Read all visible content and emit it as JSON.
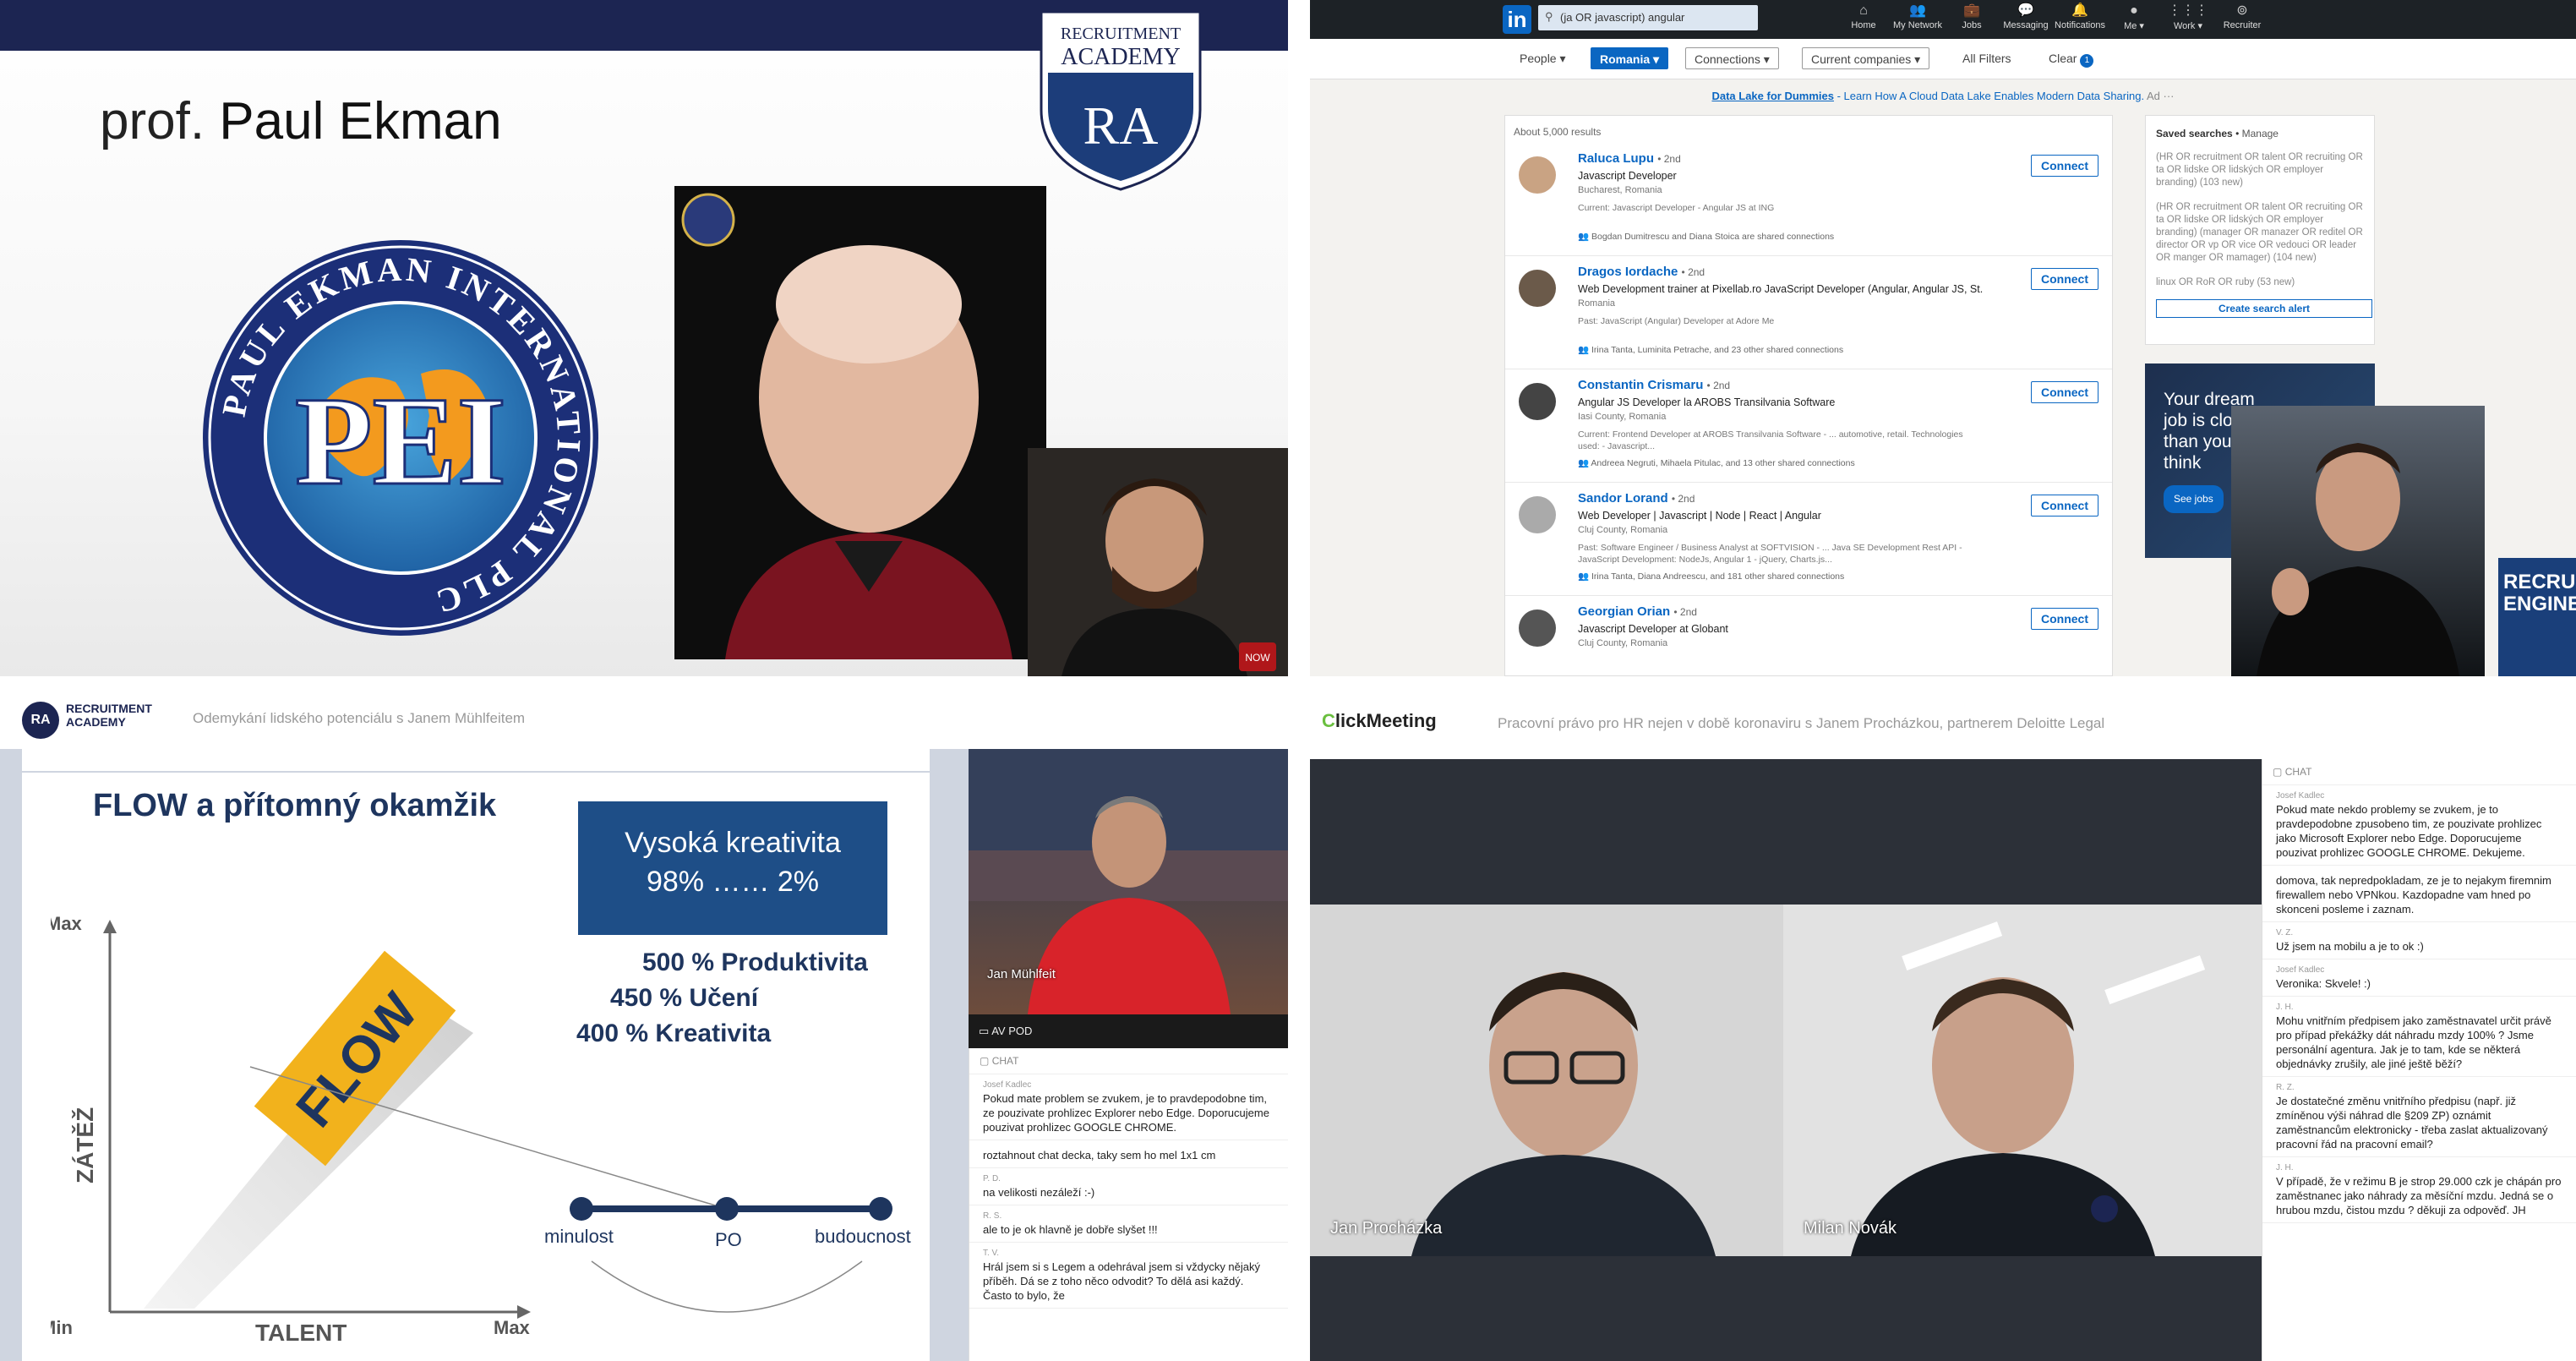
{
  "q1": {
    "title_prefix": "prof. ",
    "title_name": "Paul Ekman",
    "ra_shield": {
      "line1": "RECRUITMENT",
      "line2": "ACADEMY",
      "mono": "RA"
    },
    "pei_logo": {
      "initials": "PEI",
      "ring_text": "PAUL EKMAN INTERNATIONAL PLC"
    },
    "badge": "NOW"
  },
  "q2": {
    "search": "(ja OR javascript) angular",
    "nav": [
      {
        "icon": "home-icon",
        "glyph": "⌂",
        "label": "Home"
      },
      {
        "icon": "network-icon",
        "glyph": "👥",
        "label": "My Network"
      },
      {
        "icon": "jobs-icon",
        "glyph": "💼",
        "label": "Jobs"
      },
      {
        "icon": "messaging-icon",
        "glyph": "💬",
        "label": "Messaging"
      },
      {
        "icon": "notifications-icon",
        "glyph": "🔔",
        "label": "Notifications"
      },
      {
        "icon": "me-icon",
        "glyph": "●",
        "label": "Me ▾"
      },
      {
        "icon": "work-icon",
        "glyph": "⋮⋮⋮",
        "label": "Work ▾"
      },
      {
        "icon": "recruiter-icon",
        "glyph": "⊚",
        "label": "Recruiter"
      }
    ],
    "filters": {
      "people": "People ▾",
      "romania": "Romania ▾",
      "connections": "Connections ▾",
      "current": "Current companies ▾",
      "all": "All Filters",
      "clear": "Clear",
      "clear_count": "1"
    },
    "ad": {
      "link": "Data Lake for Dummies",
      "text": " - Learn How A Cloud Data Lake Enables Modern Data Sharing.",
      "tag": "Ad"
    },
    "count": "About 5,000 results",
    "connect_label": "Connect",
    "results": [
      {
        "name": "Raluca Lupu",
        "degree": "• 2nd",
        "headline": "Javascript Developer",
        "location": "Bucharest, Romania",
        "current": "Current: Javascript Developer - Angular JS at ING",
        "shared": "Bogdan Dumitrescu and Diana Stoica are shared connections"
      },
      {
        "name": "Dragos Iordache",
        "degree": "• 2nd",
        "headline": "Web Development trainer at Pixellab.ro JavaScript Developer (Angular, Angular JS, St...",
        "location": "Romania",
        "current": "Past: JavaScript (Angular) Developer at Adore Me",
        "shared": "Irina Tanta, Luminita Petrache, and 23 other shared connections"
      },
      {
        "name": "Constantin Crismaru",
        "degree": "• 2nd",
        "headline": "Angular JS Developer la AROBS Transilvania Software",
        "location": "Iasi County, Romania",
        "current": "Current: Frontend Developer at AROBS Transilvania Software - ... automotive, retail. Technologies used: - Javascript...",
        "shared": "Andreea Negruti, Mihaela Pitulac, and 13 other shared connections"
      },
      {
        "name": "Sandor Lorand",
        "degree": "• 2nd",
        "headline": "Web Developer | Javascript | Node | React | Angular",
        "location": "Cluj County, Romania",
        "current": "Past: Software Engineer / Business Analyst at SOFTVISION - ... Java SE Development Rest API - JavaScript Development: NodeJs, Angular 1 - jQuery, Charts.js...",
        "shared": "Irina Tanta, Diana Andreescu, and 181 other shared connections"
      },
      {
        "name": "Georgian Orian",
        "degree": "• 2nd",
        "headline": "Javascript Developer at Globant",
        "location": "Cluj County, Romania",
        "current": "",
        "shared": ""
      }
    ],
    "saved": {
      "title": "Saved searches",
      "manage": "Manage",
      "items": [
        "(HR OR recruitment OR talent OR recruiting OR ta OR lidske OR lidských OR employer branding) (103 new)",
        "(HR OR recruitment OR talent OR recruiting OR ta OR lidske OR lidských OR employer branding) (manager OR manazer OR reditel OR director OR vp OR vice OR vedouci OR leader OR manger OR mamager) (104 new)",
        "linux OR RoR OR ruby (53 new)"
      ],
      "alert": "Create search alert"
    },
    "promo": {
      "text": "Your dream job is closer than you think",
      "button": "See jobs"
    },
    "book": "RECRUIT ENGINE"
  },
  "q3": {
    "logo_mono": "RA",
    "logo_line1": "RECRUITMENT",
    "logo_line2": "ACADEMY",
    "session": "Odemykání lidského potenciálu s Janem Mühlfeitem",
    "slide_title": "FLOW a přítomný okamžik",
    "box_line1": "Vysoká kreativita",
    "box_line2": "98% …… 2%",
    "stats": [
      "500 % Produktivita",
      "450 % Učení",
      "400 % Kreativita"
    ],
    "axis": {
      "max_y": "Max",
      "min": "Min",
      "max_x": "Max",
      "ylabel": "ZÁTĚŽ",
      "xlabel": "TALENT"
    },
    "flow": "FLOW",
    "timeline": [
      "minulost",
      "PO",
      "budoucnost"
    ],
    "cam_name": "Jan Mühlfeit",
    "avpod": "AV POD",
    "chat_title": "CHAT",
    "chat": [
      {
        "user": "Josef Kadlec",
        "text": "Pokud mate problem se zvukem, je to pravdepodobne tim, ze pouzivate prohlizec Explorer nebo Edge. Doporucujeme pouzivat prohlizec GOOGLE CHROME."
      },
      {
        "user": "",
        "text": "roztahnout chat decka, taky sem ho mel 1x1 cm"
      },
      {
        "user": "P. D.",
        "text": "na velikosti nezáleží :-)"
      },
      {
        "user": "R. S.",
        "text": "ale to je ok hlavně je dobře slyšet !!!"
      },
      {
        "user": "T. V.",
        "text": "Hrál jsem si s Legem a odehrával jsem si vždycky nějaký příběh. Dá se z toho něco odvodit? To dělá asi každý. Často to bylo, že"
      }
    ]
  },
  "q4": {
    "logo_c": "C",
    "logo_rest": "lickMeeting",
    "session": "Pracovní právo pro HR nejen v době koronaviru s Janem Procházkou, partnerem Deloitte Legal",
    "cam_a": "Jan Procházka",
    "cam_b": "Milan Novák",
    "chat_title": "CHAT",
    "chat": [
      {
        "user": "Josef Kadlec",
        "text": "Pokud mate nekdo problemy se zvukem, je to pravdepodobne zpusobeno tim, ze pouzivate prohlizec jako Microsoft Explorer nebo Edge. Doporucujeme pouzivat prohlizec GOOGLE CHROME. Dekujeme."
      },
      {
        "user": "",
        "text": "domova, tak nepredpokladam, ze je to nejakym firemnim firewallem nebo VPNkou. Kazdopadne vam hned po skonceni posleme i zaznam."
      },
      {
        "user": "V. Z.",
        "text": "Už jsem na mobilu a je to ok :)"
      },
      {
        "user": "Josef Kadlec",
        "text": "Veronika: Skvele! :)"
      },
      {
        "user": "J. H.",
        "text": "Mohu vnitřním předpisem jako zaměstnavatel určit právě pro případ překážky dát náhradu mzdy 100% ? Jsme personální agentura. Jak je to tam, kde se některá objednávky zrušily, ale jiné ještě běží?"
      },
      {
        "user": "R. Z.",
        "text": "Je dostatečné změnu vnitřního předpisu (např. již zmíněnou výši náhrad dle §209 ZP) oznámit zaměstnancům elektronicky - třeba zaslat aktualizovaný pracovní řád na pracovní email?"
      },
      {
        "user": "J. H.",
        "text": "V případě, že v režimu B je strop 29.000 czk je chápán pro zaměstnanec jako náhrady za měsíční mzdu. Jedná se o hrubou mzdu, čistou mzdu ? děkuji za odpověď. JH"
      }
    ]
  }
}
